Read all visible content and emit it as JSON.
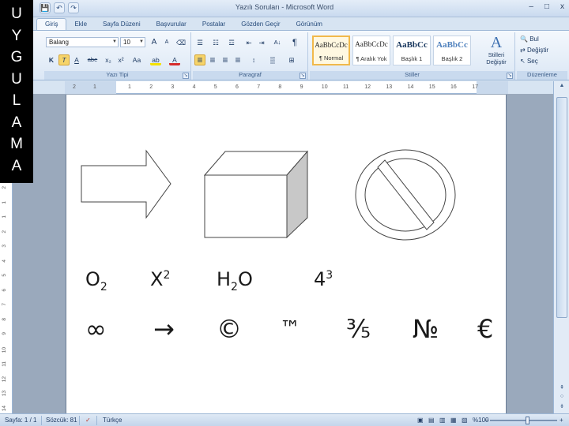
{
  "side_label": [
    "U",
    "Y",
    "G",
    "U",
    "L",
    "A",
    "M",
    "A"
  ],
  "window": {
    "title": "Yazılı Soruları - Microsoft Word",
    "minimize": "–",
    "maximize": "□",
    "close": "x",
    "qat_buttons": [
      "💾",
      "↶",
      "↷"
    ]
  },
  "tabs": [
    "Giriş",
    "Ekle",
    "Sayfa Düzeni",
    "Başvurular",
    "Postalar",
    "Gözden Geçir",
    "Görünüm"
  ],
  "active_tab_index": 0,
  "ribbon": {
    "font_group": {
      "label": "Yazı Tipi",
      "font_name": "Balang",
      "font_size": "10",
      "grow": "A",
      "shrink": "A",
      "clear": "⌫",
      "bold": "K",
      "italic": "T",
      "underline": "A",
      "strike": "abe",
      "subscript": "x₂",
      "superscript": "x²",
      "change_case": "Aa",
      "highlight": "ab",
      "font_color": "A"
    },
    "paragraph_group": {
      "label": "Paragraf",
      "bullets": "☰",
      "numbering": "☷",
      "multilevel": "☲",
      "dec_indent": "⇤",
      "inc_indent": "⇥",
      "sort": "A↓",
      "pilcrow": "¶",
      "align_left": "≡",
      "center": "≡",
      "align_right": "≡",
      "justify": "≡",
      "line_spacing": "↕",
      "shading": "▒",
      "borders": "⊞"
    },
    "styles_group": {
      "label": "Stiller",
      "tiles": [
        {
          "sample": "AaBbCcDc",
          "name": "¶ Normal"
        },
        {
          "sample": "AaBbCcDc",
          "name": "¶ Aralık Yok"
        },
        {
          "sample": "AaBbCc",
          "name": "Başlık 1"
        },
        {
          "sample": "AaBbCc",
          "name": "Başlık 2"
        }
      ],
      "change_styles": "Stilleri Değiştir"
    },
    "editing_group": {
      "label": "Düzenleme",
      "find": "Bul",
      "replace": "Değiştir",
      "select": "Seç"
    }
  },
  "ruler": {
    "labels": [
      "2",
      "1",
      "1",
      "2",
      "3",
      "4",
      "5",
      "6",
      "7",
      "8",
      "9",
      "10",
      "11",
      "12",
      "13",
      "14",
      "15",
      "16",
      "17"
    ]
  },
  "vruler": {
    "labels": [
      "2",
      "1",
      "1",
      "2",
      "3",
      "4",
      "5",
      "6",
      "7",
      "8",
      "9",
      "10",
      "11",
      "12",
      "13",
      "14"
    ]
  },
  "document": {
    "row1": [
      {
        "base": "O",
        "sub": "2",
        "sup": ""
      },
      {
        "base": "X",
        "sub": "",
        "sup": "2"
      },
      {
        "base": "H",
        "sub": "2",
        "tail": "O"
      },
      {
        "base": "4",
        "sub": "",
        "sup": "3"
      }
    ],
    "row2": [
      "∞",
      "→",
      "©",
      "™",
      "⅗",
      "№",
      "€"
    ]
  },
  "status": {
    "page": "Sayfa: 1 / 1",
    "words": "Sözcük: 81",
    "language": "Türkçe",
    "zoom": "%100",
    "zoom_minus": "–",
    "zoom_plus": "+"
  },
  "colors": {
    "accent": "#f6d46a",
    "ribbon_top": "#f4f8fd",
    "ribbon_bottom": "#dbe7f5",
    "canvas": "#9aa9bc"
  }
}
